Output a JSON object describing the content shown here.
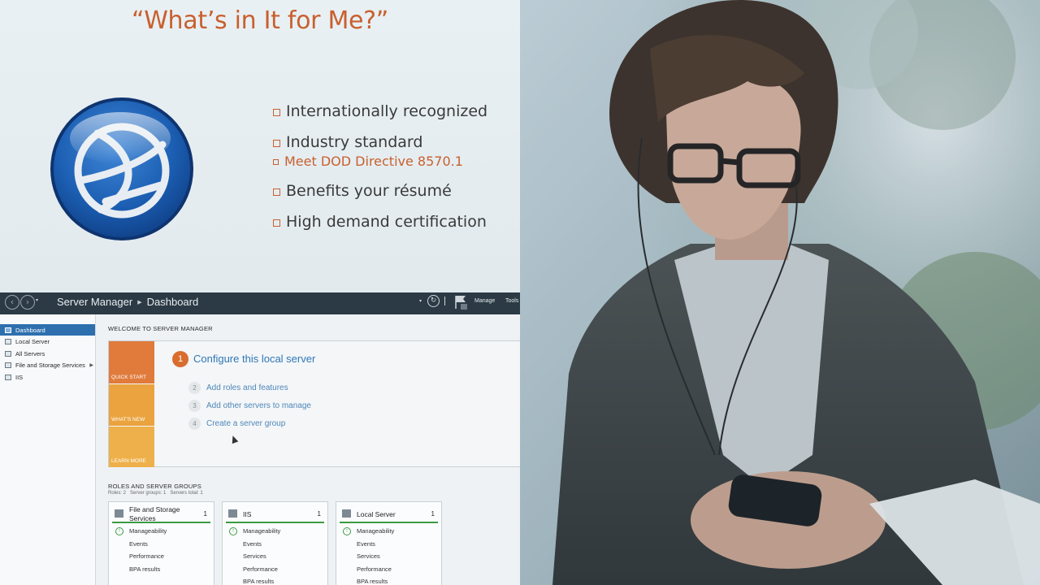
{
  "slide": {
    "title": "“What’s in It for Me?”",
    "bullets": [
      {
        "text": "Internationally recognized",
        "level": 1
      },
      {
        "text": "Industry standard",
        "level": 1
      },
      {
        "text": "Meet DOD Directive 8570.1",
        "level": 2
      },
      {
        "text": "Benefits your résumé",
        "level": 1
      },
      {
        "text": "High demand certification",
        "level": 1
      }
    ],
    "accent_color": "#c8602d",
    "logo_icon": "globe-icon"
  },
  "server_manager": {
    "breadcrumb_app": "Server Manager",
    "breadcrumb_page": "Dashboard",
    "menu": [
      "Manage",
      "Tools"
    ],
    "sidebar": [
      {
        "label": "Dashboard",
        "active": true
      },
      {
        "label": "Local Server"
      },
      {
        "label": "All Servers"
      },
      {
        "label": "File and Storage Services"
      },
      {
        "label": "IIS"
      }
    ],
    "welcome": {
      "title": "WELCOME TO SERVER MANAGER",
      "tiles": [
        "QUICK START",
        "WHAT'S NEW",
        "LEARN MORE"
      ],
      "step1": {
        "num": "1",
        "label": "Configure this local server"
      },
      "steps": [
        {
          "num": "2",
          "label": "Add roles and features"
        },
        {
          "num": "3",
          "label": "Add other servers to manage"
        },
        {
          "num": "4",
          "label": "Create a server group"
        }
      ]
    },
    "roles": {
      "title": "ROLES AND SERVER GROUPS",
      "summary": [
        "Roles: 2",
        "Server groups: 1",
        "Servers total: 1"
      ],
      "cards": [
        {
          "name": "File and Storage Services",
          "count": "1",
          "rows": [
            "Manageability",
            "Events",
            "Performance",
            "BPA results"
          ]
        },
        {
          "name": "IIS",
          "count": "1",
          "rows": [
            "Manageability",
            "Events",
            "Services",
            "Performance",
            "BPA results"
          ]
        },
        {
          "name": "Local Server",
          "count": "1",
          "rows": [
            "Manageability",
            "Events",
            "Services",
            "Performance",
            "BPA results"
          ]
        }
      ]
    }
  }
}
